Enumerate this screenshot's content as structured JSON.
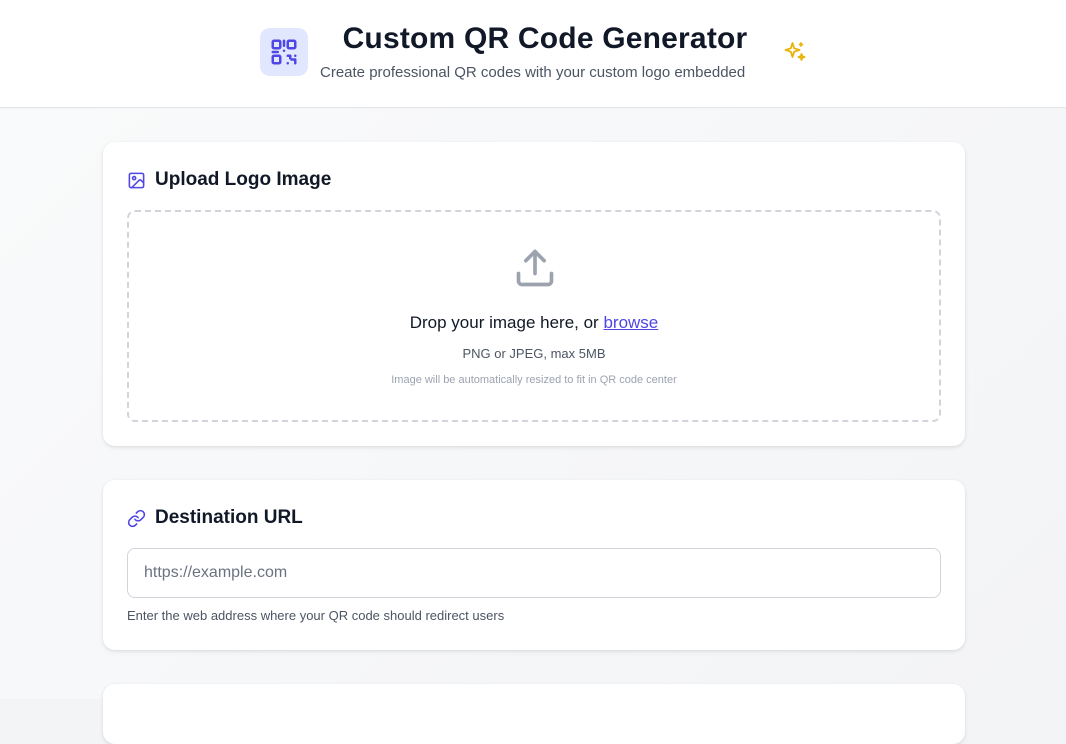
{
  "header": {
    "title": "Custom QR Code Generator",
    "subtitle": "Create professional QR codes with your custom logo embedded",
    "logo_icon": "qr-code-icon",
    "decor_icon": "sparkles-icon"
  },
  "upload": {
    "title": "Upload Logo Image",
    "icon": "image-icon",
    "drop_text": "Drop your image here, or",
    "browse_label": "browse",
    "format_hint": "PNG or JPEG, max 5MB",
    "resize_hint": "Image will be automatically resized to fit in QR code center"
  },
  "destination": {
    "title": "Destination URL",
    "icon": "link-icon",
    "placeholder": "https://example.com",
    "value": "",
    "hint": "Enter the web address where your QR code should redirect users"
  },
  "colors": {
    "accent": "#4f46e5",
    "accent_light": "#e0e7ff",
    "sparkle": "#eab308"
  }
}
